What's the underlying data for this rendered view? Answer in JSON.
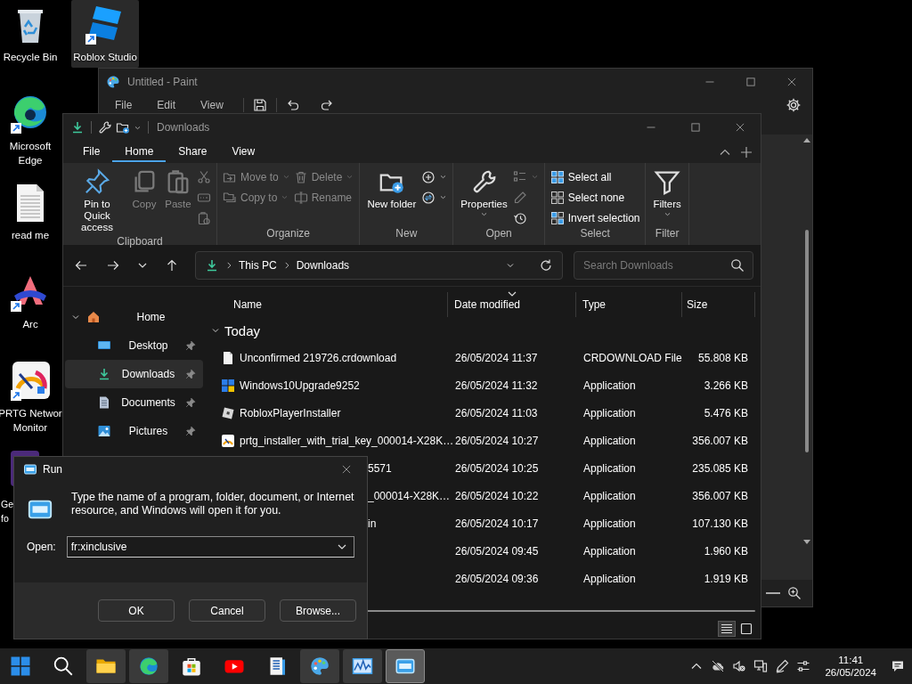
{
  "desktop_icons": [
    {
      "label_lines": [
        "Recycle Bin"
      ],
      "kind": "recycle",
      "shortcut": false,
      "selected": false
    },
    {
      "label_lines": [
        "Microsoft",
        "Edge"
      ],
      "kind": "edge",
      "shortcut": true,
      "selected": false
    },
    {
      "label_lines": [
        "read me"
      ],
      "kind": "document",
      "shortcut": false,
      "selected": false
    },
    {
      "label_lines": [
        "Arc"
      ],
      "kind": "arc",
      "shortcut": true,
      "selected": false
    },
    {
      "label_lines": [
        "PRTG Networ",
        "Monitor"
      ],
      "kind": "prtg",
      "shortcut": true,
      "selected": false
    },
    {
      "label_lines": [
        "Ge",
        "fo"
      ],
      "kind": "partial",
      "selected": false
    },
    {
      "label_lines": [
        "Roblox Studio"
      ],
      "kind": "studio",
      "shortcut": true,
      "selected": true
    }
  ],
  "paint": {
    "title": "Untitled - Paint",
    "menu": [
      "File",
      "Edit",
      "View"
    ]
  },
  "explorer": {
    "title": "Downloads",
    "tabs": [
      {
        "label": "File",
        "selected": false
      },
      {
        "label": "Home",
        "selected": true
      },
      {
        "label": "Share",
        "selected": false
      },
      {
        "label": "View",
        "selected": false
      }
    ],
    "ribbon": [
      {
        "label": "Clipboard",
        "items": [
          {
            "kind": "large",
            "label": "Pin to Quick access",
            "disabled": false
          },
          {
            "kind": "large",
            "label": "Copy",
            "disabled": true
          },
          {
            "kind": "large",
            "label": "Paste",
            "disabled": true
          },
          {
            "kind": "stack",
            "items": [
              {
                "kind": "icon",
                "disabled": true
              },
              {
                "kind": "icon",
                "disabled": true
              },
              {
                "kind": "icon",
                "disabled": true
              }
            ]
          }
        ]
      },
      {
        "label": "Organize",
        "items": [
          {
            "kind": "stack",
            "items": [
              {
                "kind": "small",
                "label": "Move to",
                "dropdown": true,
                "disabled": true
              },
              {
                "kind": "small",
                "label": "Copy to",
                "dropdown": true,
                "disabled": true
              }
            ]
          },
          {
            "kind": "stack",
            "items": [
              {
                "kind": "small",
                "label": "Delete",
                "dropdown": true,
                "disabled": true
              },
              {
                "kind": "small",
                "label": "Rename",
                "dropdown": false,
                "disabled": true
              }
            ]
          }
        ]
      },
      {
        "label": "New",
        "items": [
          {
            "kind": "large",
            "label": "New folder",
            "disabled": false
          },
          {
            "kind": "stack",
            "items": [
              {
                "kind": "icon",
                "dropdown": true,
                "disabled": false
              },
              {
                "kind": "icon",
                "dropdown": true,
                "disabled": false
              }
            ]
          }
        ]
      },
      {
        "label": "Open",
        "items": [
          {
            "kind": "large",
            "label": "Properties",
            "dropdown": true,
            "disabled": false
          },
          {
            "kind": "stack",
            "items": [
              {
                "kind": "icon",
                "dropdown": true,
                "disabled": true
              },
              {
                "kind": "icon",
                "disabled": true
              },
              {
                "kind": "icon",
                "disabled": false
              }
            ]
          }
        ]
      },
      {
        "label": "Select",
        "items": [
          {
            "kind": "stack",
            "items": [
              {
                "kind": "small",
                "label": "Select all",
                "disabled": false
              },
              {
                "kind": "small",
                "label": "Select none",
                "disabled": false
              },
              {
                "kind": "small",
                "label": "Invert selection",
                "disabled": false
              }
            ]
          }
        ]
      },
      {
        "label": "Filter",
        "items": [
          {
            "kind": "large",
            "label": "Filters",
            "dropdown": true,
            "disabled": false
          }
        ]
      }
    ],
    "address": [
      "This PC",
      "Downloads"
    ],
    "search": {
      "placeholder": "Search Downloads"
    },
    "sidebar": [
      {
        "label": "Home",
        "kind": "home",
        "expanded": true,
        "children": [
          {
            "label": "Desktop",
            "kind": "desktop",
            "pinned": true,
            "selected": false
          },
          {
            "label": "Downloads",
            "kind": "download",
            "pinned": true,
            "selected": true
          },
          {
            "label": "Documents",
            "kind": "documents",
            "pinned": true,
            "selected": false
          },
          {
            "label": "Pictures",
            "kind": "pictures",
            "pinned": true,
            "selected": false
          }
        ]
      }
    ],
    "columns": [
      {
        "label": "Name",
        "sorted": false
      },
      {
        "label": "Date modified",
        "sorted": true
      },
      {
        "label": "Type",
        "sorted": false
      },
      {
        "label": "Size",
        "sorted": false
      }
    ],
    "groups": [
      {
        "label": "Today",
        "expanded": true,
        "rows": [
          {
            "name": "Unconfirmed 219726.crdownload",
            "kind": "file",
            "date": "26/05/2024 11:37",
            "type": "CRDOWNLOAD File",
            "size": "55.808 KB"
          },
          {
            "name": "Windows10Upgrade9252",
            "kind": "windows",
            "date": "26/05/2024 11:32",
            "type": "Application",
            "size": "3.266 KB"
          },
          {
            "name": "RobloxPlayerInstaller",
            "kind": "roblox",
            "date": "26/05/2024 11:03",
            "type": "Application",
            "size": "5.476 KB"
          },
          {
            "name": "prtg_installer_with_trial_key_000014-X28K…",
            "kind": "prtg",
            "date": "26/05/2024 10:27",
            "type": "Application",
            "size": "356.007 KB"
          },
          {
            "name": "5571",
            "covered": true,
            "date": "26/05/2024 10:25",
            "type": "Application",
            "size": "235.085 KB"
          },
          {
            "name": "_000014-X28K…",
            "covered": true,
            "date": "26/05/2024 10:22",
            "type": "Application",
            "size": "356.007 KB"
          },
          {
            "name": "in",
            "covered": true,
            "date": "26/05/2024 10:17",
            "type": "Application",
            "size": "107.130 KB"
          },
          {
            "covered": true,
            "date": "26/05/2024 09:45",
            "type": "Application",
            "size": "1.960 KB"
          },
          {
            "covered": true,
            "date": "26/05/2024 09:36",
            "type": "Application",
            "size": "1.919 KB"
          }
        ]
      }
    ],
    "views": [
      {
        "kind": "details",
        "selected": true
      },
      {
        "kind": "tiles",
        "selected": false
      }
    ]
  },
  "run": {
    "title": "Run",
    "prompt": "Type the name of a program, folder, document, or Internet resource, and Windows will open it for you.",
    "open_label": "Open:",
    "value": "fr:xinclusive",
    "buttons": [
      "OK",
      "Cancel",
      "Browse..."
    ]
  },
  "taskbar": {
    "apps": [
      {
        "kind": "start",
        "open": false,
        "focused": false
      },
      {
        "kind": "search",
        "open": false,
        "focused": false
      },
      {
        "kind": "folder",
        "open": true,
        "focused": false
      },
      {
        "kind": "edge",
        "open": true,
        "focused": false
      },
      {
        "kind": "store",
        "open": false,
        "focused": false
      },
      {
        "kind": "youtube",
        "open": false,
        "focused": false
      },
      {
        "kind": "book",
        "open": false,
        "focused": false
      },
      {
        "kind": "paint",
        "open": true,
        "focused": false
      },
      {
        "kind": "monitor",
        "open": true,
        "focused": false
      },
      {
        "kind": "run",
        "open": true,
        "focused": true
      }
    ],
    "time": "11:41",
    "date": "26/05/2024"
  }
}
